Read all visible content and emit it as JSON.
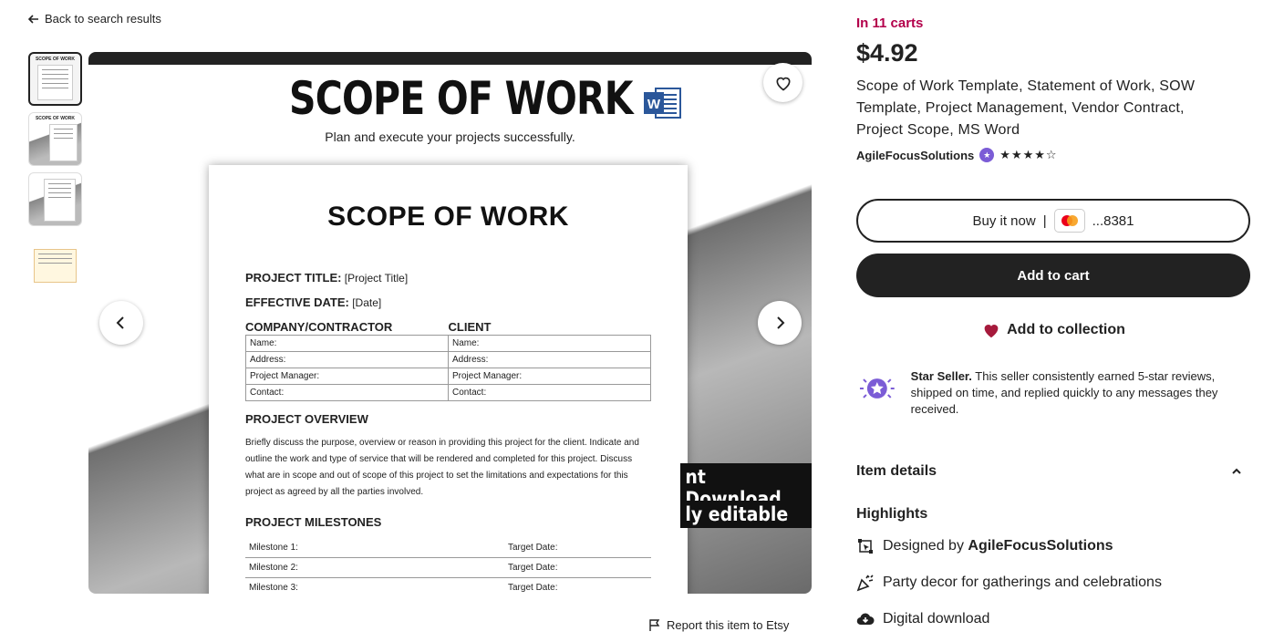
{
  "nav": {
    "back_label": "Back to search results"
  },
  "gallery": {
    "thumb_title": "SCOPE OF WORK",
    "main": {
      "title": "SCOPE OF WORK",
      "subtitle": "Plan and execute your projects successfully.",
      "banner_1": "nt Download",
      "banner_2": "ly editable",
      "doc": {
        "title": "SCOPE OF WORK",
        "project_title_label": "PROJECT TITLE:",
        "project_title_value": "[Project Title]",
        "effective_date_label": "EFFECTIVE DATE:",
        "effective_date_value": "[Date]",
        "col_left": "COMPANY/CONTRACTOR",
        "col_right": "CLIENT",
        "info_rows": [
          "Name:",
          "Address:",
          "Project Manager:",
          "Contact:"
        ],
        "overview_heading": "PROJECT OVERVIEW",
        "overview_text": "Briefly discuss the purpose, overview or reason in providing this project for the client. Indicate and outline the work and type of service that will be rendered and completed for this project. Discuss what are in scope and out of scope of this project to set the limitations and expectations for this project as agreed by all the parties involved.",
        "milestones_heading": "PROJECT MILESTONES",
        "milestones": [
          {
            "label": "Milestone 1:",
            "target": "Target Date:"
          },
          {
            "label": "Milestone 2:",
            "target": "Target Date:"
          },
          {
            "label": "Milestone 3:",
            "target": "Target Date:"
          }
        ]
      }
    },
    "report_label": "Report this item to Etsy"
  },
  "product": {
    "in_carts": "In 11 carts",
    "price": "$4.92",
    "title": "Scope of Work Template, Statement of Work, SOW Template, Project Management, Vendor Contract, Project Scope, MS Word",
    "seller": "AgileFocusSolutions",
    "rating": 4.5,
    "stars_display": "★★★★☆",
    "buy_now_label": "Buy it now",
    "card_last4": "...8381",
    "add_to_cart_label": "Add to cart",
    "add_to_collection_label": "Add to collection",
    "star_seller_title": "Star Seller.",
    "star_seller_text": " This seller consistently earned 5-star reviews, shipped on time, and replied quickly to any messages they received.",
    "item_details_label": "Item details",
    "highlights_label": "Highlights",
    "highlights": {
      "designed_by_prefix": "Designed by ",
      "designed_by_name": "AgileFocusSolutions",
      "party": "Party decor for gatherings and celebrations",
      "digital": "Digital download"
    }
  },
  "colors": {
    "in_carts": "#b3004b",
    "cart_button": "#222222",
    "heart": "#a61a3c",
    "star_seller": "#7b5cd6"
  }
}
